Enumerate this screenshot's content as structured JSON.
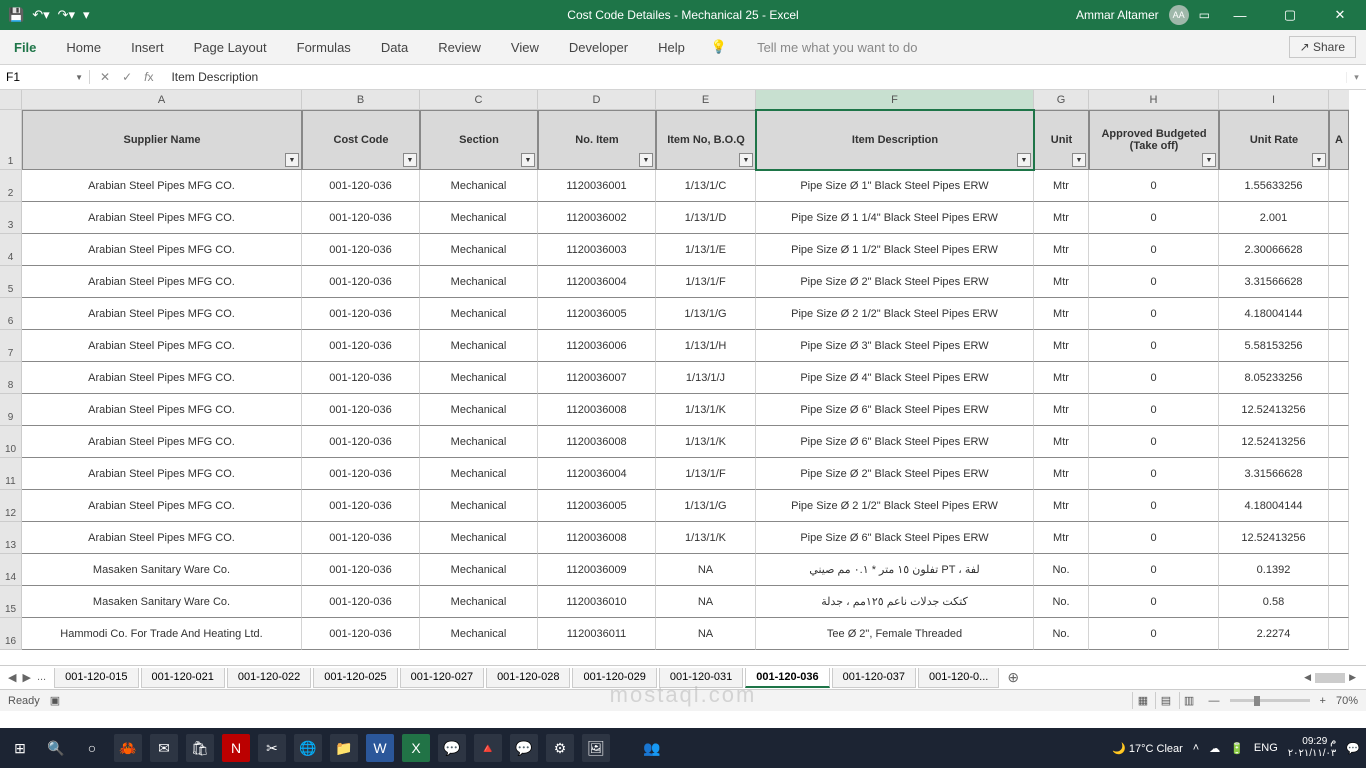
{
  "titlebar": {
    "title": "Cost Code Detailes - Mechanical 25  -  Excel",
    "user": "Ammar Altamer",
    "userInitials": "AA"
  },
  "ribbon": {
    "tabs": [
      "File",
      "Home",
      "Insert",
      "Page Layout",
      "Formulas",
      "Data",
      "Review",
      "View",
      "Developer",
      "Help"
    ],
    "tellme": "Tell me what you want to do",
    "share": "Share"
  },
  "fx": {
    "cell": "F1",
    "value": "Item Description"
  },
  "columns": [
    {
      "letter": "A",
      "key": "supplier",
      "label": "Supplier Name",
      "cls": "c-A"
    },
    {
      "letter": "B",
      "key": "cost",
      "label": "Cost Code",
      "cls": "c-B"
    },
    {
      "letter": "C",
      "key": "section",
      "label": "Section",
      "cls": "c-C"
    },
    {
      "letter": "D",
      "key": "noitem",
      "label": "No. Item",
      "cls": "c-D"
    },
    {
      "letter": "E",
      "key": "boq",
      "label": "Item No, B.O.Q",
      "cls": "c-E"
    },
    {
      "letter": "F",
      "key": "desc",
      "label": "Item Description",
      "cls": "c-F"
    },
    {
      "letter": "G",
      "key": "unit",
      "label": "Unit",
      "cls": "c-G"
    },
    {
      "letter": "H",
      "key": "budget",
      "label": "Approved Budgeted (Take off)",
      "cls": "c-H"
    },
    {
      "letter": "I",
      "key": "rate",
      "label": "Unit Rate",
      "cls": "c-I"
    }
  ],
  "rows": [
    {
      "r": "2",
      "supplier": "Arabian Steel Pipes MFG CO.",
      "cost": "001-120-036",
      "section": "Mechanical",
      "noitem": "1120036001",
      "boq": "1/13/1/C",
      "desc": "Pipe Size Ø 1\" Black Steel Pipes ERW",
      "unit": "Mtr",
      "budget": "0",
      "rate": "1.55633256"
    },
    {
      "r": "3",
      "supplier": "Arabian Steel Pipes MFG CO.",
      "cost": "001-120-036",
      "section": "Mechanical",
      "noitem": "1120036002",
      "boq": "1/13/1/D",
      "desc": "Pipe Size Ø 1 1/4\" Black Steel Pipes ERW",
      "unit": "Mtr",
      "budget": "0",
      "rate": "2.001"
    },
    {
      "r": "4",
      "supplier": "Arabian Steel Pipes MFG CO.",
      "cost": "001-120-036",
      "section": "Mechanical",
      "noitem": "1120036003",
      "boq": "1/13/1/E",
      "desc": "Pipe Size Ø 1 1/2\" Black Steel Pipes ERW",
      "unit": "Mtr",
      "budget": "0",
      "rate": "2.30066628"
    },
    {
      "r": "5",
      "supplier": "Arabian Steel Pipes MFG CO.",
      "cost": "001-120-036",
      "section": "Mechanical",
      "noitem": "1120036004",
      "boq": "1/13/1/F",
      "desc": "Pipe Size Ø 2\" Black Steel Pipes ERW",
      "unit": "Mtr",
      "budget": "0",
      "rate": "3.31566628"
    },
    {
      "r": "6",
      "supplier": "Arabian Steel Pipes MFG CO.",
      "cost": "001-120-036",
      "section": "Mechanical",
      "noitem": "1120036005",
      "boq": "1/13/1/G",
      "desc": "Pipe Size Ø 2 1/2\" Black Steel Pipes ERW",
      "unit": "Mtr",
      "budget": "0",
      "rate": "4.18004144"
    },
    {
      "r": "7",
      "supplier": "Arabian Steel Pipes MFG CO.",
      "cost": "001-120-036",
      "section": "Mechanical",
      "noitem": "1120036006",
      "boq": "1/13/1/H",
      "desc": "Pipe Size Ø 3\" Black Steel Pipes ERW",
      "unit": "Mtr",
      "budget": "0",
      "rate": "5.58153256"
    },
    {
      "r": "8",
      "supplier": "Arabian Steel Pipes MFG CO.",
      "cost": "001-120-036",
      "section": "Mechanical",
      "noitem": "1120036007",
      "boq": "1/13/1/J",
      "desc": "Pipe Size Ø 4\" Black Steel Pipes ERW",
      "unit": "Mtr",
      "budget": "0",
      "rate": "8.05233256"
    },
    {
      "r": "9",
      "supplier": "Arabian Steel Pipes MFG CO.",
      "cost": "001-120-036",
      "section": "Mechanical",
      "noitem": "1120036008",
      "boq": "1/13/1/K",
      "desc": "Pipe Size Ø 6\" Black Steel Pipes ERW",
      "unit": "Mtr",
      "budget": "0",
      "rate": "12.52413256"
    },
    {
      "r": "10",
      "supplier": "Arabian Steel Pipes MFG CO.",
      "cost": "001-120-036",
      "section": "Mechanical",
      "noitem": "1120036008",
      "boq": "1/13/1/K",
      "desc": "Pipe Size Ø 6\" Black Steel Pipes ERW",
      "unit": "Mtr",
      "budget": "0",
      "rate": "12.52413256"
    },
    {
      "r": "11",
      "supplier": "Arabian Steel Pipes MFG CO.",
      "cost": "001-120-036",
      "section": "Mechanical",
      "noitem": "1120036004",
      "boq": "1/13/1/F",
      "desc": "Pipe Size Ø 2\" Black Steel Pipes ERW",
      "unit": "Mtr",
      "budget": "0",
      "rate": "3.31566628"
    },
    {
      "r": "12",
      "supplier": "Arabian Steel Pipes MFG CO.",
      "cost": "001-120-036",
      "section": "Mechanical",
      "noitem": "1120036005",
      "boq": "1/13/1/G",
      "desc": "Pipe Size Ø 2 1/2\" Black Steel Pipes ERW",
      "unit": "Mtr",
      "budget": "0",
      "rate": "4.18004144"
    },
    {
      "r": "13",
      "supplier": "Arabian Steel Pipes MFG CO.",
      "cost": "001-120-036",
      "section": "Mechanical",
      "noitem": "1120036008",
      "boq": "1/13/1/K",
      "desc": "Pipe Size Ø 6\" Black Steel Pipes ERW",
      "unit": "Mtr",
      "budget": "0",
      "rate": "12.52413256"
    },
    {
      "r": "14",
      "supplier": "Masaken Sanitary Ware Co.",
      "cost": "001-120-036",
      "section": "Mechanical",
      "noitem": "1120036009",
      "boq": "NA",
      "desc": "تفلون ١٥ متر * ٠.١ مم صيني PT ، لفة",
      "unit": "No.",
      "budget": "0",
      "rate": "0.1392"
    },
    {
      "r": "15",
      "supplier": "Masaken Sanitary Ware Co.",
      "cost": "001-120-036",
      "section": "Mechanical",
      "noitem": "1120036010",
      "boq": "NA",
      "desc": "كتكت جدلات ناعم ١٢٥مم ، جدلة",
      "unit": "No.",
      "budget": "0",
      "rate": "0.58"
    },
    {
      "r": "16",
      "supplier": "Hammodi Co. For Trade And Heating Ltd.",
      "cost": "001-120-036",
      "section": "Mechanical",
      "noitem": "1120036011",
      "boq": "NA",
      "desc": "Tee Ø 2\", Female Threaded",
      "unit": "No.",
      "budget": "0",
      "rate": "2.2274"
    }
  ],
  "partialCol": "A",
  "sheets": {
    "nav_more": "...",
    "tabs": [
      "001-120-015",
      "001-120-021",
      "001-120-022",
      "001-120-025",
      "001-120-027",
      "001-120-028",
      "001-120-029",
      "001-120-031",
      "001-120-036",
      "001-120-037",
      "001-120-0..."
    ],
    "active": "001-120-036"
  },
  "status": {
    "ready": "Ready",
    "zoom": "70%"
  },
  "taskbar": {
    "weather": "17°C  Clear",
    "lang": "ENG",
    "time": "09:29 م",
    "date": "٢٠٢١/١١/٠٣"
  },
  "watermark": "mostaql.com"
}
